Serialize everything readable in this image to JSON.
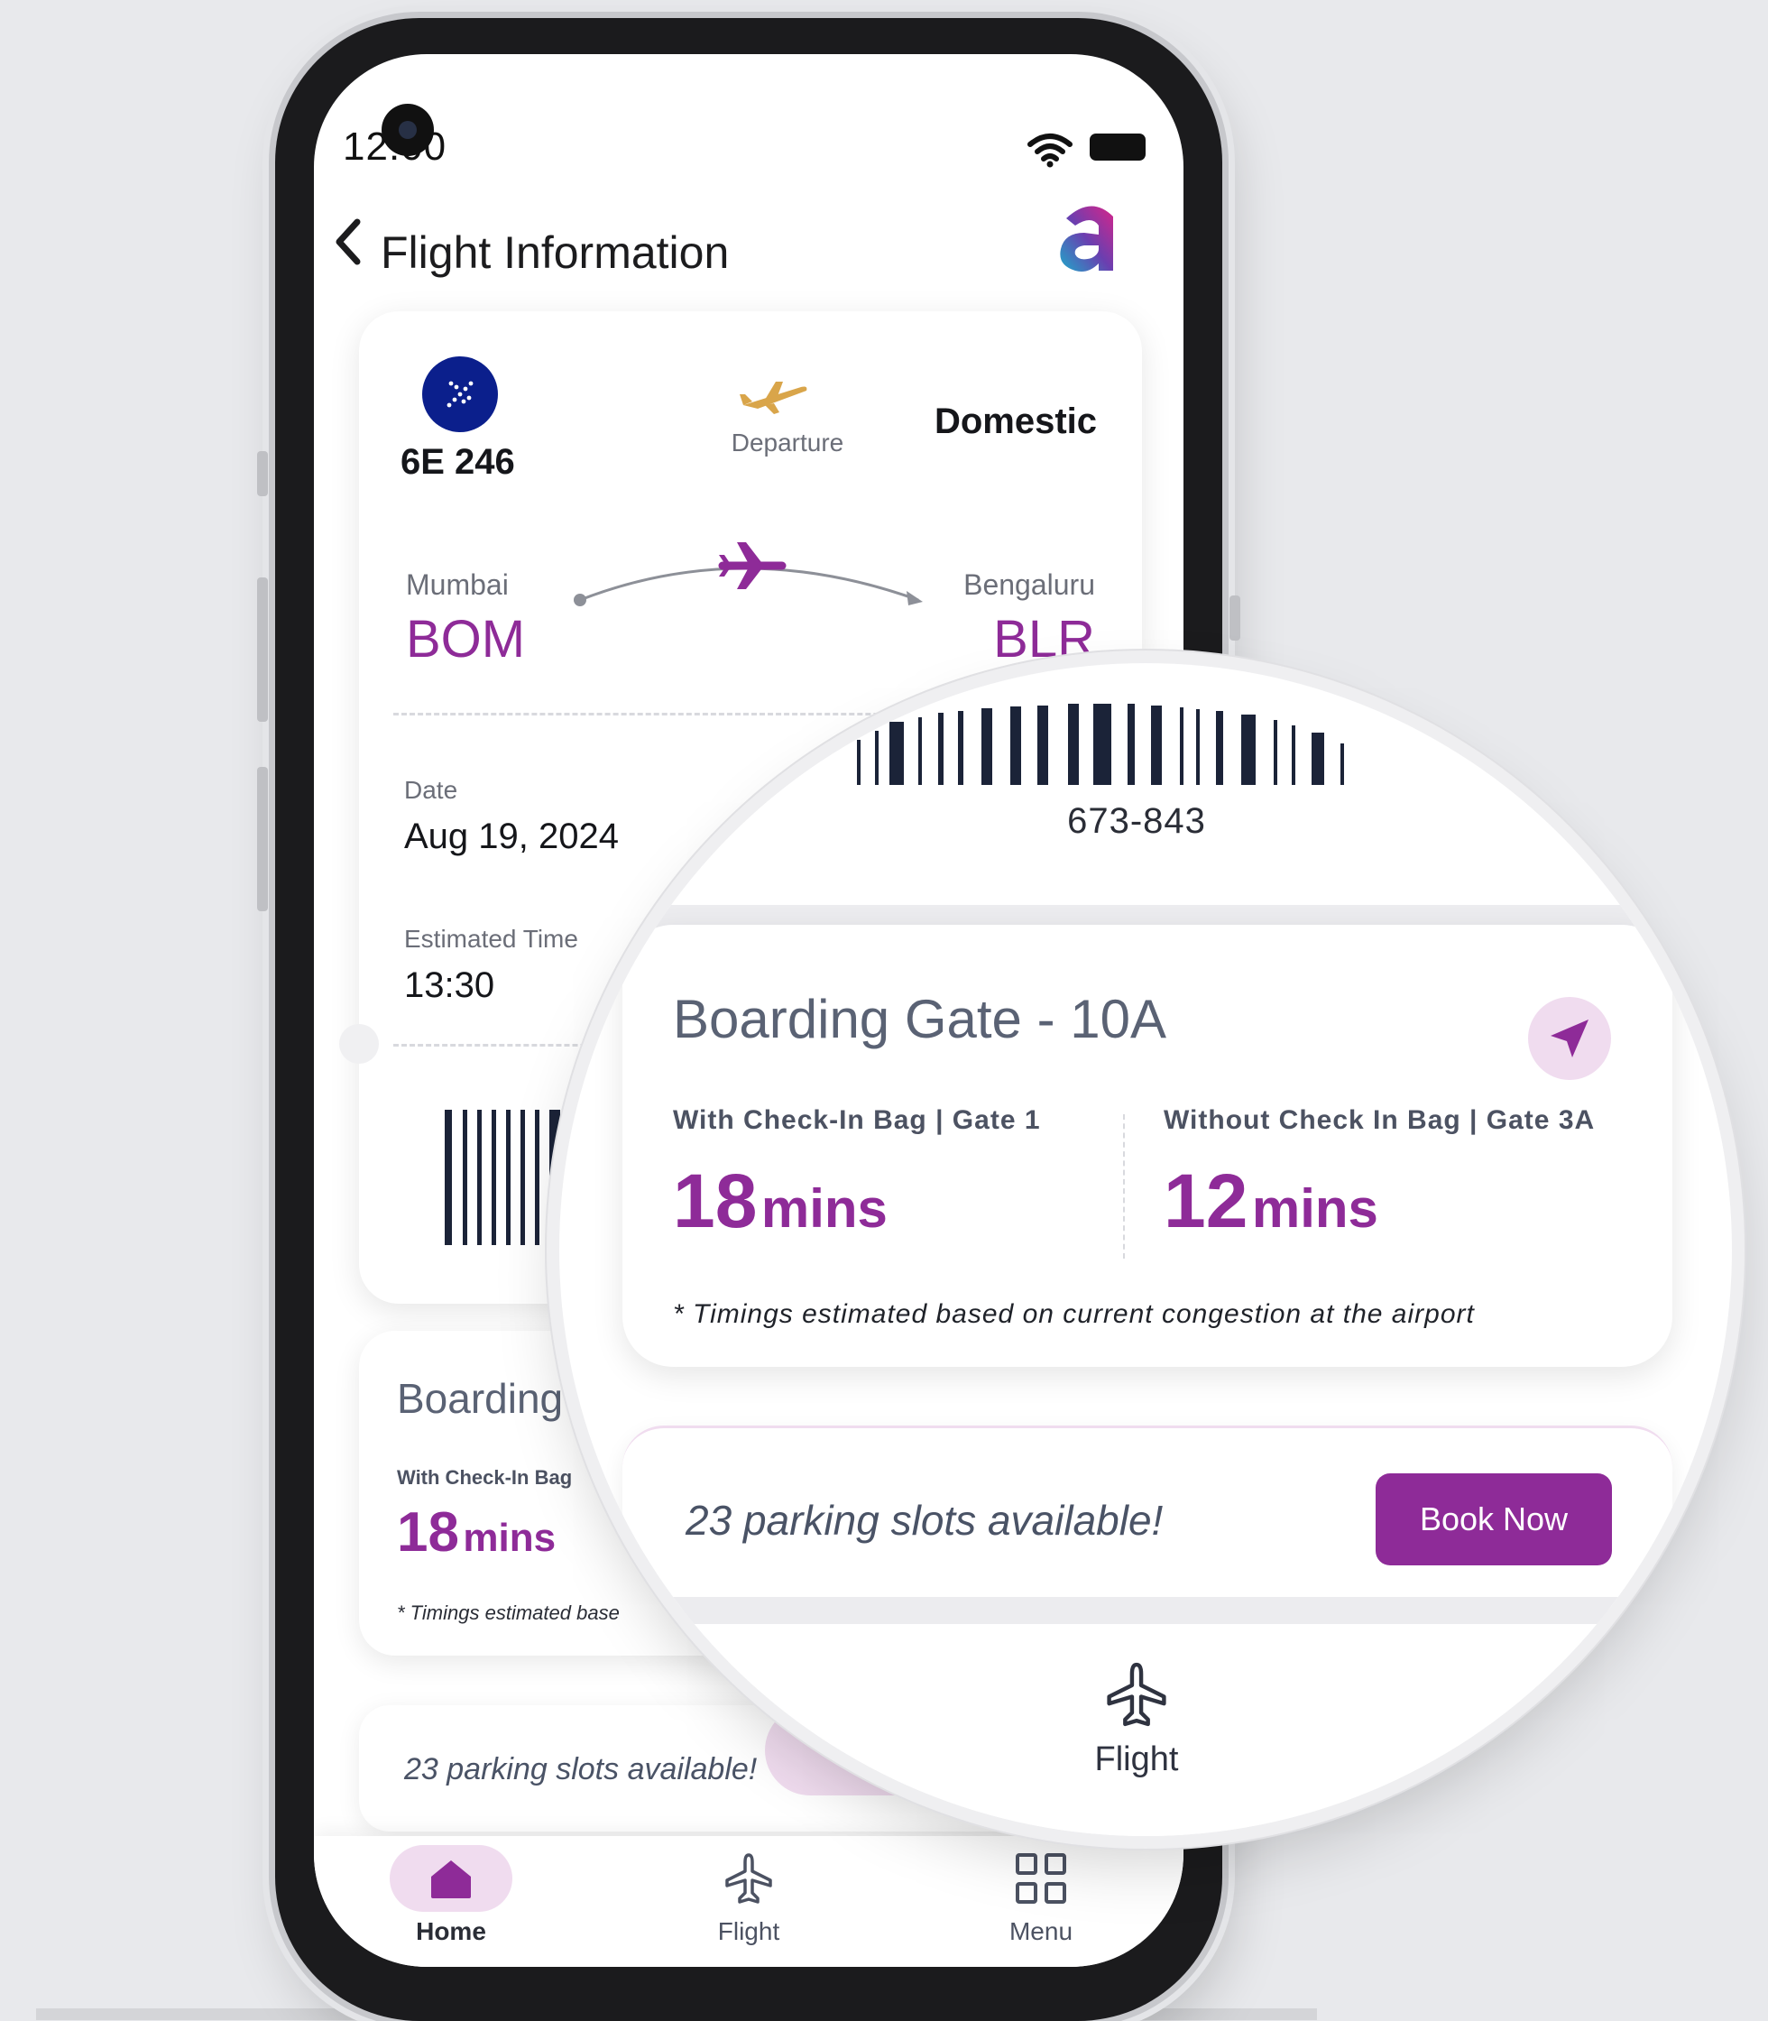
{
  "status_bar": {
    "time": "12:00"
  },
  "header": {
    "title": "Flight Information"
  },
  "ticket": {
    "flight_number": "6E 246",
    "direction": "Departure",
    "type": "Domestic",
    "origin": {
      "city": "Mumbai",
      "code": "BOM"
    },
    "destination": {
      "city": "Bengaluru",
      "code": "BLR"
    },
    "date_label": "Date",
    "date_value": "Aug 19, 2024",
    "time_label": "Estimated Time",
    "time_value": "13:30",
    "ticket_number": "673-843"
  },
  "boarding": {
    "title": "Boarding Gate - 10A",
    "with_bag_label": "With Check-In Bag | Gate 1",
    "with_bag_label_short": "With Check-In Bag",
    "with_bag_minutes": "18",
    "without_bag_label": "Without Check In Bag  |  Gate 3A",
    "without_bag_minutes": "12",
    "unit": "mins",
    "title_short": "Boarding",
    "note": "* Timings estimated based on current congestion at the airport",
    "note_short": "* Timings estimated base"
  },
  "parking": {
    "text": "23 parking slots available!",
    "button": "Book Now"
  },
  "bottom_nav": {
    "items": [
      {
        "label": "Home",
        "icon": "home-icon",
        "active": true
      },
      {
        "label": "Flight",
        "icon": "plane-icon",
        "active": false
      },
      {
        "label": "Menu",
        "icon": "grid-icon",
        "active": false
      }
    ]
  },
  "colors": {
    "accent": "#8e2b98",
    "accent_soft": "#f0dcef",
    "airline_blue": "#0b1f8c",
    "departure_gold": "#d9a54a",
    "text_muted": "#6b6e78"
  }
}
